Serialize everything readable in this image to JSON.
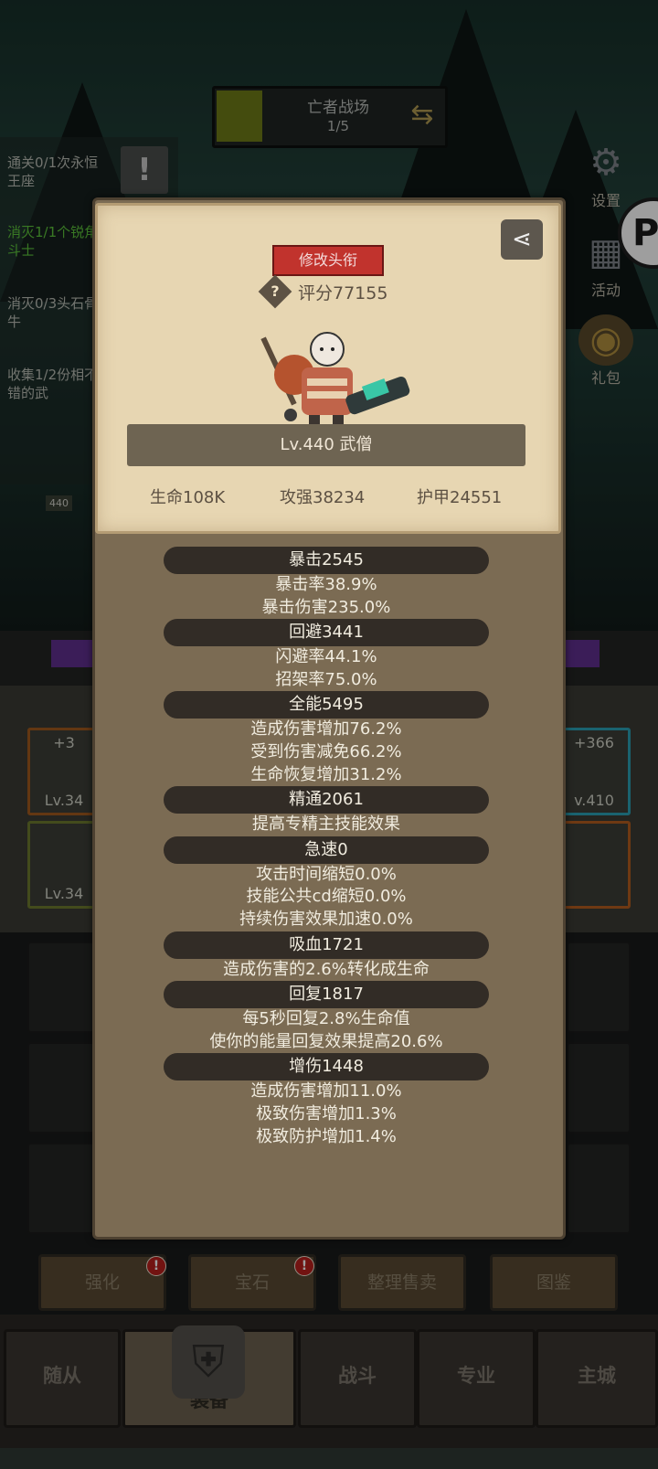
{
  "stage": {
    "title": "亡者战场",
    "progress": "1/5"
  },
  "quests": [
    {
      "text": "通关0/1次永恒王座",
      "done": false
    },
    {
      "text": "消灭1/1个锐角斗士",
      "done": true
    },
    {
      "text": "消灭0/3头石骨牛",
      "done": false
    },
    {
      "text": "收集1/2份相不错的武",
      "done": false
    }
  ],
  "side_icons": [
    {
      "label": "设置",
      "icon": "gear-icon"
    },
    {
      "label": "活动",
      "icon": "calendar-icon"
    },
    {
      "label": "礼包",
      "icon": "gift-icon"
    }
  ],
  "slots": {
    "left_top": {
      "plus": "+3",
      "level": "Lv.34"
    },
    "left_bottom": {
      "level": "Lv.34"
    },
    "right_top": {
      "plus": "+366",
      "level": "v.410"
    },
    "hero_small_level": "440"
  },
  "popup": {
    "change_title_label": "修改头衔",
    "score_text": "评分77155",
    "name_text": "Lv.440 武僧",
    "stats": [
      "生命108K",
      "攻强38234",
      "护甲24551"
    ]
  },
  "details": [
    {
      "header": "暴击2545",
      "lines": [
        "暴击率38.9%",
        "暴击伤害235.0%"
      ]
    },
    {
      "header": "回避3441",
      "lines": [
        "闪避率44.1%",
        "招架率75.0%"
      ]
    },
    {
      "header": "全能5495",
      "lines": [
        "造成伤害增加76.2%",
        "受到伤害减免66.2%",
        "生命恢复增加31.2%"
      ]
    },
    {
      "header": "精通2061",
      "lines": [
        "提高专精主技能效果"
      ]
    },
    {
      "header": "急速0",
      "lines": [
        "攻击时间缩短0.0%",
        "技能公共cd缩短0.0%",
        "持续伤害效果加速0.0%"
      ]
    },
    {
      "header": "吸血1721",
      "lines": [
        "造成伤害的2.6%转化成生命"
      ]
    },
    {
      "header": "回复1817",
      "lines": [
        "每5秒回复2.8%生命值",
        "使你的能量回复效果提高20.6%"
      ]
    },
    {
      "header": "增伤1448",
      "lines": [
        "造成伤害增加11.0%",
        "极致伤害增加1.3%",
        "极致防护增加1.4%"
      ]
    }
  ],
  "sub_buttons": [
    "强化",
    "宝石",
    "整理售卖",
    "图鉴"
  ],
  "tabs": [
    "随从",
    "装备",
    "战斗",
    "专业",
    "主城"
  ],
  "colors": {
    "accent_red": "#c1332d",
    "card_bg": "#e7d6b2",
    "popup_bg": "#7b6b53",
    "header_bg": "#322c26"
  }
}
